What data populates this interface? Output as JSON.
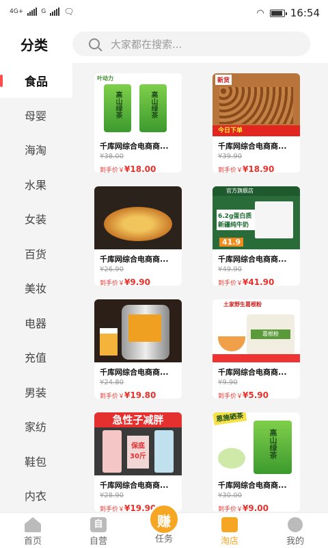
{
  "status_bar": {
    "network": "4G+",
    "network2": "G",
    "time": "16:54"
  },
  "header": {
    "title": "分类",
    "search_placeholder": "大家都在搜索..."
  },
  "sidebar": {
    "items": [
      {
        "label": "食品",
        "active": true
      },
      {
        "label": "母婴"
      },
      {
        "label": "海淘"
      },
      {
        "label": "水果"
      },
      {
        "label": "女装"
      },
      {
        "label": "百货"
      },
      {
        "label": "美妆"
      },
      {
        "label": "电器"
      },
      {
        "label": "充值"
      },
      {
        "label": "男装"
      },
      {
        "label": "家纺"
      },
      {
        "label": "鞋包"
      },
      {
        "label": "内衣"
      }
    ]
  },
  "products": [
    {
      "name": "千库网综合电商商...",
      "orig": "¥38.00",
      "deal_label": "到手价￥",
      "price": "¥18.00",
      "thumb": {
        "type": "tea",
        "logo": "叶动力",
        "bag_text": "高山绿茶"
      }
    },
    {
      "name": "千库网综合电商商...",
      "orig": "¥39.90",
      "deal_label": "到手价￥",
      "price": "¥18.90",
      "thumb": {
        "type": "nuts",
        "tag": "新货",
        "band": "今日下单"
      }
    },
    {
      "name": "千库网综合电商商...",
      "orig": "¥26.90",
      "deal_label": "到手价￥",
      "price": "¥9.90",
      "thumb": {
        "type": "noodle"
      }
    },
    {
      "name": "千库网综合电商商...",
      "orig": "¥49.90",
      "deal_label": "到手价￥",
      "price": "¥41.90",
      "thumb": {
        "type": "milk",
        "top": "官方旗舰店",
        "text": "6.2g蛋白质 新疆纯牛奶",
        "price": "41.9"
      }
    },
    {
      "name": "千库网综合电商商...",
      "orig": "¥24.80",
      "deal_label": "到手价￥",
      "price": "¥19.80",
      "thumb": {
        "type": "keg"
      }
    },
    {
      "name": "千库网综合电商商...",
      "orig": "¥9.90",
      "deal_label": "到手价￥",
      "price": "¥5.90",
      "thumb": {
        "type": "root",
        "head": "土家野生葛根粉",
        "jar": "葛根粉"
      }
    },
    {
      "name": "千库网综合电商商...",
      "orig": "¥28.90",
      "deal_label": "到手价￥",
      "price": "¥19.90",
      "thumb": {
        "type": "diet",
        "head": "急性子减胖",
        "mid": "保底30斤"
      }
    },
    {
      "name": "千库网综合电商商...",
      "orig": "¥30.00",
      "deal_label": "到手价￥",
      "price": "¥9.00",
      "thumb": {
        "type": "tea2",
        "badge": "恩施硒茶",
        "bag_text": "高山绿茶"
      }
    }
  ],
  "tabbar": {
    "items": [
      {
        "label": "首页",
        "icon": "home-icon"
      },
      {
        "label": "自营",
        "icon": "self-operated-icon",
        "icon_text": "自"
      },
      {
        "label": "任务",
        "icon": "earn-icon",
        "icon_text": "赚"
      },
      {
        "label": "淘店",
        "icon": "cart-icon",
        "active": true
      },
      {
        "label": "我的",
        "icon": "profile-icon"
      }
    ]
  },
  "colors": {
    "accent": "#f5a623",
    "price": "#e8302a",
    "sidebar_active_bar": "#ff4d4d"
  }
}
